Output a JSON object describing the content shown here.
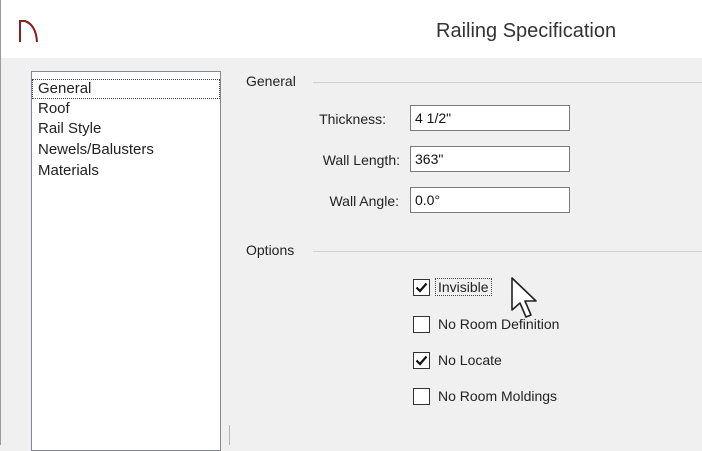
{
  "window": {
    "title": "Railing Specification",
    "icon": "railing-app-icon"
  },
  "nav": {
    "items": [
      {
        "label": "General",
        "selected": true
      },
      {
        "label": "Roof",
        "selected": false
      },
      {
        "label": "Rail Style",
        "selected": false
      },
      {
        "label": "Newels/Balusters",
        "selected": false
      },
      {
        "label": "Materials",
        "selected": false
      }
    ]
  },
  "general_group": {
    "label": "General",
    "thickness": {
      "label": "Thickness:",
      "value": "4 1/2\""
    },
    "wall_length": {
      "label": "Wall Length:",
      "value": "363\""
    },
    "wall_angle": {
      "label": "Wall Angle:",
      "value": "0.0°"
    }
  },
  "options_group": {
    "label": "Options",
    "checkboxes": [
      {
        "label": "Invisible",
        "checked": true,
        "focused": true
      },
      {
        "label": "No Room Definition",
        "checked": false,
        "focused": false
      },
      {
        "label": "No Locate",
        "checked": true,
        "focused": false
      },
      {
        "label": "No Room Moldings",
        "checked": false,
        "focused": false
      }
    ]
  },
  "colors": {
    "titlebar_bg": "#ffffff",
    "dialog_bg": "#f0f0f0",
    "list_border": "#828790"
  }
}
